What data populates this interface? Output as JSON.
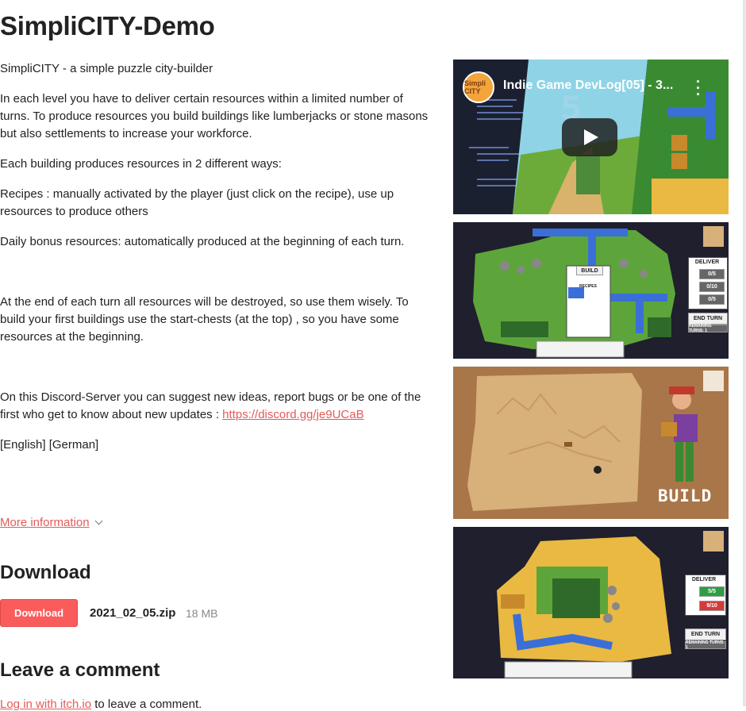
{
  "page": {
    "title": "SimpliCITY-Demo",
    "description": {
      "p1": "SimpliCITY - a simple puzzle city-builder",
      "p2": "In each level you have to deliver certain resources within a limited number of turns. To produce resources you build buildings like lumberjacks or stone masons  but also  settlements to increase your workforce.",
      "p3": "Each building produces resources in 2 different ways:",
      "p4": "Recipes : manually activated by the player (just click on the recipe), use up resources to produce others",
      "p5": "Daily bonus resources: automatically produced at the beginning of each turn.",
      "p6": "At the end of each turn all resources will be destroyed, so use them wisely. To build your first buildings use the start-chests (at the top) , so you have some resources at the beginning.",
      "p7_prefix": "On  this Discord-Server you can suggest new ideas, report bugs or be one of the first who get to know about new updates : ",
      "p7_link": "https://discord.gg/je9UCaB",
      "p8": "[English] [German]"
    },
    "more_information": "More information"
  },
  "download": {
    "heading": "Download",
    "button_label": "Download",
    "file_name": "2021_02_05.zip",
    "file_size": "18 MB"
  },
  "comments": {
    "heading": "Leave a comment",
    "login_link": "Log in with itch.io",
    "login_suffix": " to leave a comment."
  },
  "media": {
    "video": {
      "title": "Indie Game DevLog[05] - 3...",
      "channel_logo_text": "Simpli CITY",
      "menu_icon": "more-vert-icon",
      "play_icon": "play-icon"
    },
    "screenshot2": {
      "deliver_label": "DELIVER",
      "counters": [
        "0/5",
        "0/10",
        "0/5"
      ],
      "build_label": "BUILD",
      "recipes_label": "RECIPES",
      "end_turn_label": "END TURN",
      "remaining_turns_label": "REMAINING TURNS: 1"
    },
    "screenshot3": {
      "build_word": "BUILD"
    },
    "screenshot4": {
      "deliver_label": "DELIVER",
      "counters": [
        "5/5",
        "9/10"
      ],
      "end_turn_label": "END TURN",
      "remaining_turns_label": "REMAINING TURNS: 1"
    }
  },
  "colors": {
    "accent": "#fa5c5c",
    "link": "#e35a5a",
    "text": "#222222",
    "muted": "#888888",
    "grass": "#5da53a",
    "water": "#3a6fd8",
    "sand": "#e9b941",
    "map_bg": "#d8b07a"
  }
}
